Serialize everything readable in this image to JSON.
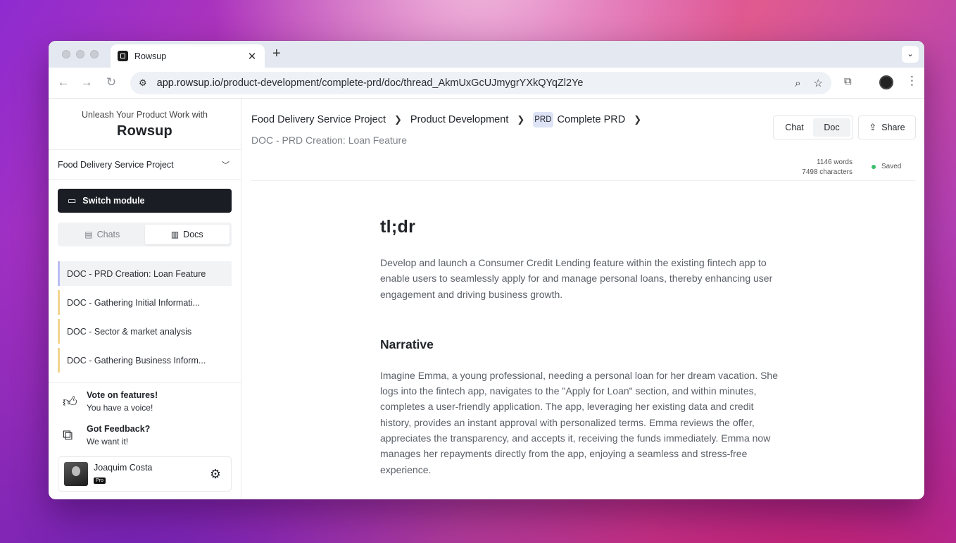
{
  "browser": {
    "tab_title": "Rowsup",
    "url_host": "app.rowsup.io",
    "url_path": "/product-development/complete-prd/doc/thread_AkmUxGcUJmygrYXkQYqZl2Ye"
  },
  "sidebar": {
    "tagline": "Unleash Your Product Work with",
    "brand": "Rowsup",
    "project": "Food Delivery Service Project",
    "switch_label": "Switch module",
    "tabs": [
      {
        "label": "Chats"
      },
      {
        "label": "Docs"
      }
    ],
    "docs": [
      {
        "label": "DOC - PRD Creation: Loan Feature"
      },
      {
        "label": "DOC - Gathering Initial Informati..."
      },
      {
        "label": "DOC - Sector & market analysis"
      },
      {
        "label": "DOC - Gathering Business Inform..."
      }
    ],
    "vote": {
      "title": "Vote on features!",
      "sub": "You have a voice!"
    },
    "feedback": {
      "title": "Got Feedback?",
      "sub": "We want it!"
    },
    "user": {
      "name": "Joaquim Costa",
      "badge": "Pro"
    }
  },
  "header": {
    "crumbs": [
      "Food Delivery Service Project",
      "Product Development",
      "Complete PRD"
    ],
    "prd_badge": "PRD",
    "subtitle": "DOC - PRD Creation: Loan Feature",
    "view_chat": "Chat",
    "view_doc": "Doc",
    "share": "Share",
    "words": "1146 words",
    "characters": "7498 characters",
    "status": "Saved"
  },
  "doc": {
    "h1": "tl;dr",
    "p1": "Develop and launch a Consumer Credit Lending feature within the existing fintech app to enable users to seamlessly apply for and manage personal loans, thereby enhancing user engagement and driving business growth.",
    "h2": "Narrative",
    "p2": "Imagine Emma, a young professional, needing a personal loan for her dream vacation. She logs into the fintech app, navigates to the \"Apply for Loan\" section, and within minutes, completes a user-friendly application. The app, leveraging her existing data and credit history, provides an instant approval with personalized terms. Emma reviews the offer, appreciates the transparency, and accepts it, receiving the funds immediately. Emma now manages her repayments directly from the app, enjoying a seamless and stress-free experience."
  }
}
